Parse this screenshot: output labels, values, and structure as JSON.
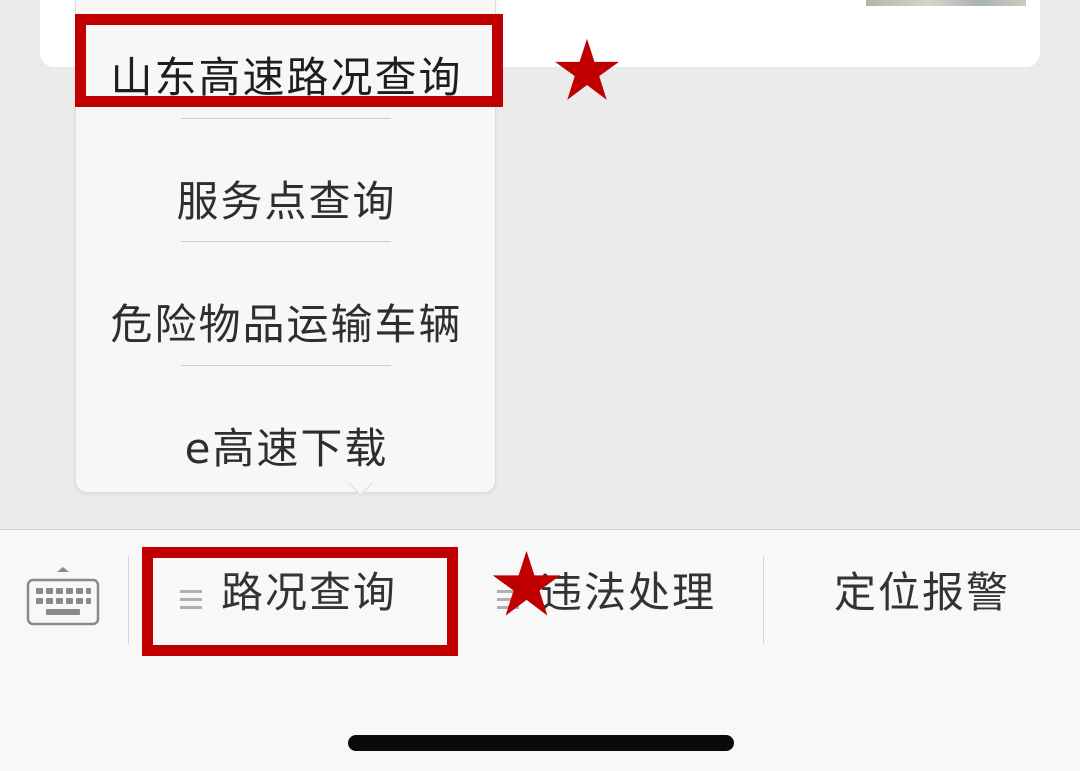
{
  "popup_menu": {
    "items": [
      {
        "label": "山东高速路况查询"
      },
      {
        "label": "服务点查询"
      },
      {
        "label": "危险物品运输车辆"
      },
      {
        "label": "e高速下载"
      }
    ]
  },
  "bottom_menu": {
    "keyboard_icon": "keyboard-icon",
    "tabs": [
      {
        "label": "路况查询",
        "icon": "menu-lines-icon"
      },
      {
        "label": "违法处理",
        "icon": "menu-lines-icon"
      },
      {
        "label": "定位报警"
      }
    ]
  },
  "annotations": {
    "highlight_color": "#c00000",
    "star_color": "#c00000"
  },
  "colors": {
    "background": "#ebebeb",
    "popup_background": "#f7f7f7",
    "tab_bar_background": "#f8f8f8",
    "text": "#333333"
  }
}
